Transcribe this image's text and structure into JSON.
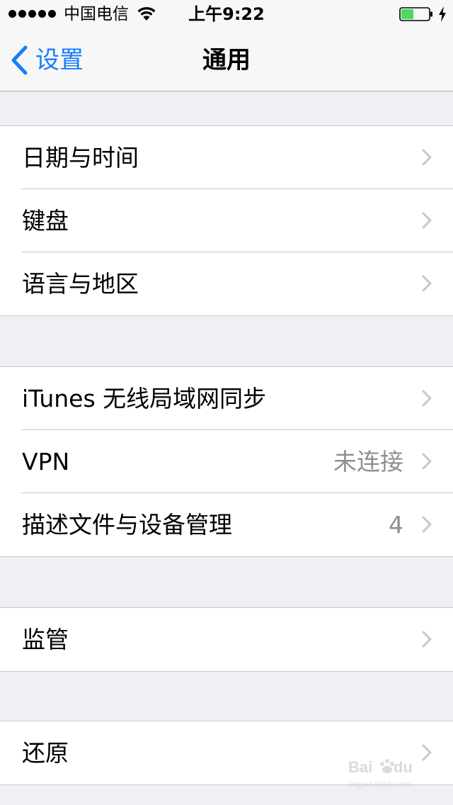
{
  "status_bar": {
    "carrier": "中国电信",
    "time": "上午9:22",
    "icons": [
      "signal-dots-icon",
      "wifi-icon",
      "battery-icon",
      "charging-bolt-icon"
    ],
    "battery_level": 0.45,
    "battery_color": "#4cd964"
  },
  "nav": {
    "back_label": "设置",
    "title": "通用",
    "accent_color": "#157efb"
  },
  "groups": [
    {
      "rows": [
        {
          "label": "日期与时间",
          "value": ""
        },
        {
          "label": "键盘",
          "value": ""
        },
        {
          "label": "语言与地区",
          "value": ""
        }
      ]
    },
    {
      "rows": [
        {
          "label": "iTunes 无线局域网同步",
          "value": ""
        },
        {
          "label": "VPN",
          "value": "未连接"
        },
        {
          "label": "描述文件与设备管理",
          "value": "4"
        }
      ]
    },
    {
      "rows": [
        {
          "label": "监管",
          "value": ""
        }
      ]
    },
    {
      "rows": [
        {
          "label": "还原",
          "value": ""
        }
      ]
    }
  ],
  "watermark": {
    "text": "Baidu 经验",
    "sub": "jingyan.baidu.com"
  }
}
